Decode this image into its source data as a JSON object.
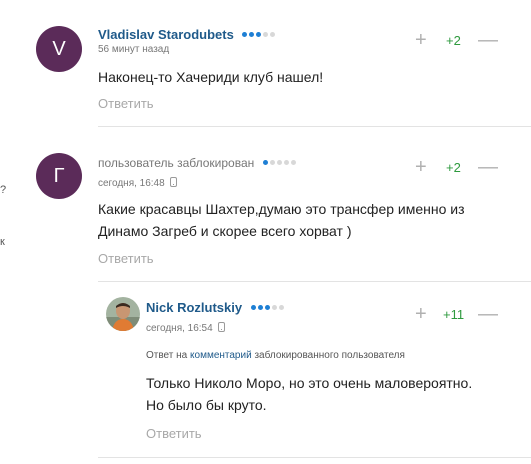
{
  "left_edge": {
    "marks": [
      "?",
      "к"
    ]
  },
  "comments": [
    {
      "avatar_letter": "V",
      "author": "Vladislav Starodubets",
      "time": "56 минут назад",
      "rating_dots": 3,
      "score": "+2",
      "text": "Наконец-то Хачериди клуб нашел!",
      "reply_label": "Ответить"
    },
    {
      "avatar_letter": "Г",
      "author": "пользователь заблокирован",
      "time": "сегодня, 16:48",
      "rating_dots": 1,
      "score": "+2",
      "text_lines": [
        "Какие красавцы Шахтер,думаю это трансфер именно из",
        "Динамо Загреб и скорее всего хорват )"
      ],
      "reply_label": "Ответить"
    },
    {
      "author": "Nick Rozlutskiy",
      "time": "сегодня, 16:54",
      "rating_dots": 3,
      "score": "+11",
      "reply_to": {
        "prefix": "Ответ на",
        "link": "комментарий",
        "suffix": "заблокированного пользователя"
      },
      "text_lines": [
        "Только Николо Моро, но это очень маловероятно.",
        "Но было бы круто."
      ],
      "reply_label": "Ответить"
    }
  ],
  "controls": {
    "plus": "+",
    "minus": "—"
  },
  "colors": {
    "avatar": "#5b2b59",
    "author": "#1f5a8a",
    "score": "#2e9a3e",
    "dot_on": "#1e7fd4"
  }
}
